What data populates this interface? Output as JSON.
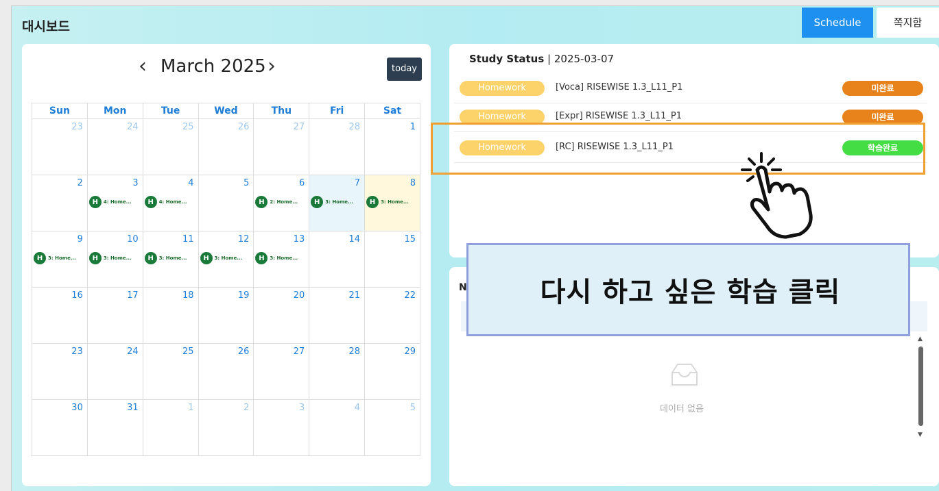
{
  "app": {
    "title": "대시보드"
  },
  "topbar": {
    "schedule_label": "Schedule",
    "note_label": "쪽지함"
  },
  "calendar": {
    "prev_label": "‹",
    "next_label": "›",
    "month_title": "March 2025",
    "today_label": "today",
    "weekdays": [
      "Sun",
      "Mon",
      "Tue",
      "Wed",
      "Thu",
      "Fri",
      "Sat"
    ],
    "weeks": [
      [
        {
          "d": "23",
          "o": true
        },
        {
          "d": "24",
          "o": true
        },
        {
          "d": "25",
          "o": true
        },
        {
          "d": "26",
          "o": true
        },
        {
          "d": "27",
          "o": true
        },
        {
          "d": "28",
          "o": true
        },
        {
          "d": "1"
        }
      ],
      [
        {
          "d": "2"
        },
        {
          "d": "3",
          "e": "4: Home..."
        },
        {
          "d": "4",
          "e": "4: Home..."
        },
        {
          "d": "5"
        },
        {
          "d": "6",
          "e": "2: Home..."
        },
        {
          "d": "7",
          "e": "3: Home...",
          "sel": true
        },
        {
          "d": "8",
          "e": "3: Home...",
          "today": true
        }
      ],
      [
        {
          "d": "9",
          "e": "3: Home..."
        },
        {
          "d": "10",
          "e": "3: Home..."
        },
        {
          "d": "11",
          "e": "3: Home..."
        },
        {
          "d": "12",
          "e": "3: Home..."
        },
        {
          "d": "13",
          "e": "3: Home..."
        },
        {
          "d": "14"
        },
        {
          "d": "15"
        }
      ],
      [
        {
          "d": "16"
        },
        {
          "d": "17"
        },
        {
          "d": "18"
        },
        {
          "d": "19"
        },
        {
          "d": "20"
        },
        {
          "d": "21"
        },
        {
          "d": "22"
        }
      ],
      [
        {
          "d": "23"
        },
        {
          "d": "24"
        },
        {
          "d": "25"
        },
        {
          "d": "26"
        },
        {
          "d": "27"
        },
        {
          "d": "28"
        },
        {
          "d": "29"
        }
      ],
      [
        {
          "d": "30"
        },
        {
          "d": "31"
        },
        {
          "d": "1",
          "o": true
        },
        {
          "d": "2",
          "o": true
        },
        {
          "d": "3",
          "o": true
        },
        {
          "d": "4",
          "o": true
        },
        {
          "d": "5",
          "o": true
        }
      ]
    ],
    "event_badge": "H"
  },
  "study_status": {
    "label": "Study Status",
    "separator": " | ",
    "date": "2025-03-07",
    "rows": [
      {
        "type": "Homework",
        "title": "[Voca] RISEWISE 1.3_L11_P1",
        "status": "미완료",
        "state": "todo"
      },
      {
        "type": "Homework",
        "title": "[Expr] RISEWISE 1.3_L11_P1",
        "status": "미완료",
        "state": "todo"
      },
      {
        "type": "Homework",
        "title": "[RC] RISEWISE 1.3_L11_P1",
        "status": "학습완료",
        "state": "done"
      }
    ]
  },
  "notice": {
    "heading_initial": "N",
    "empty_text": "데이터 없음"
  },
  "overlay": {
    "tooltip_text": "다시 하고 싶은 학습 클릭"
  },
  "colors": {
    "accent": "#1e90f0",
    "todo": "#e8821a",
    "done": "#44dd44",
    "pill": "#fcd36a",
    "highlight": "#f0a030"
  }
}
